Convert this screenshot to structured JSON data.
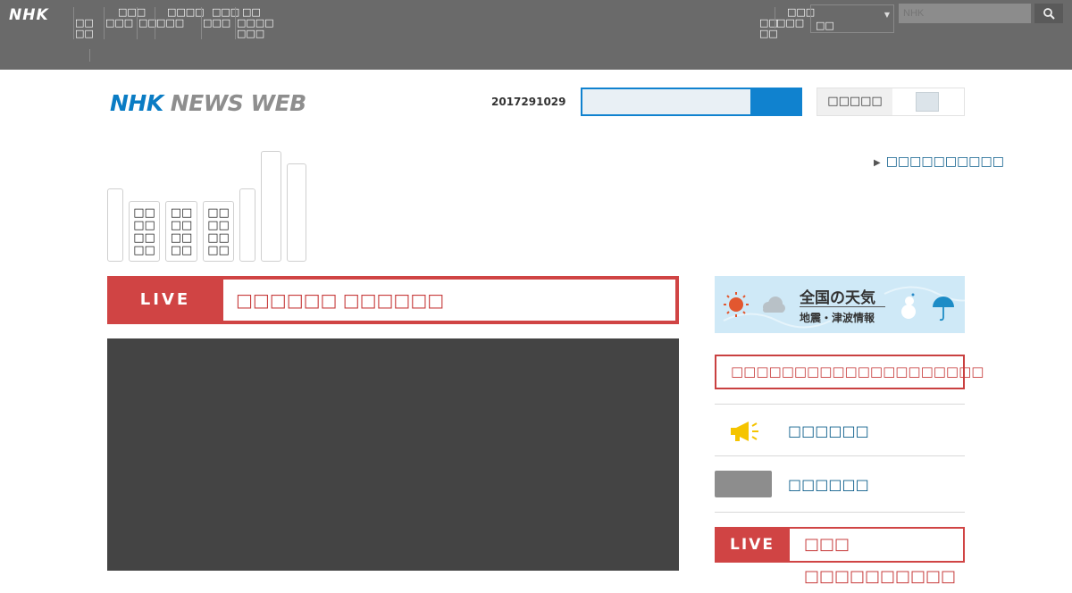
{
  "global": {
    "logo": "NHK",
    "nav": [
      {
        "lines": [
          "□□",
          "□□"
        ]
      },
      {
        "lines": [
          "□□□",
          "□□□"
        ]
      },
      {
        "lines": [
          "□□"
        ]
      },
      {
        "lines": [
          "□□□□",
          "□□□"
        ]
      },
      {
        "lines": [
          "□□□",
          "□□□"
        ]
      },
      {
        "lines": [
          "□□",
          "□□□□",
          "□□□"
        ]
      }
    ],
    "right_nav": [
      {
        "lines": [
          "□□",
          "□□"
        ]
      },
      {
        "lines": [
          "□□□",
          "□□□"
        ]
      }
    ],
    "select_value": "□□",
    "search_placeholder": "NHK"
  },
  "header": {
    "logo_nhk": "NHK",
    "logo_newsweb": "NEWS WEB",
    "number": "2017291029",
    "toggle_label": "□□□□□"
  },
  "tag_link": "□□□□□□□□□□",
  "categories": [
    {
      "lines": [
        ""
      ]
    },
    {
      "lines": [
        "□□",
        "□□",
        "□□",
        "□□"
      ]
    },
    {
      "lines": [
        "□□",
        "□□",
        "□□",
        "□□"
      ]
    },
    {
      "lines": [
        "□□",
        "□□",
        "□□",
        "□□"
      ]
    },
    {
      "lines": [
        ""
      ]
    },
    {
      "lines": [
        ""
      ]
    },
    {
      "lines": [
        ""
      ]
    }
  ],
  "live_main": {
    "label": "LIVE",
    "title": "□□□□□□ □□□□□□"
  },
  "weather": {
    "title": "全国の天気",
    "subtitle": "地震・津波情報"
  },
  "alert": "□□□□□□□□□□□□□□□□□□□□",
  "side_links": [
    {
      "label": "□□□□□□"
    },
    {
      "label": "□□□□□□"
    }
  ],
  "live_side": {
    "label": "LIVE",
    "title": "□□□ □□□□□□□□□□"
  },
  "colors": {
    "accent_blue": "#1082cf",
    "live_red": "#d04444",
    "link_blue": "#0a5c8a",
    "topbar_gray": "#6a6a6a"
  }
}
